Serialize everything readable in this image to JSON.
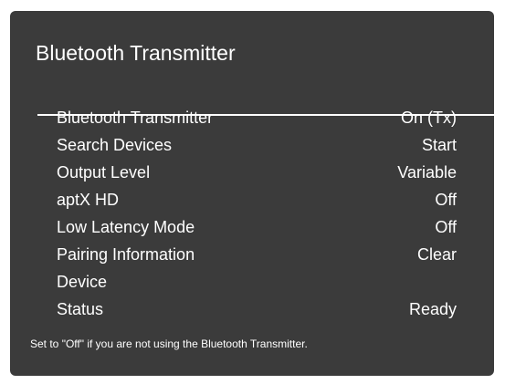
{
  "panel": {
    "title": "Bluetooth Transmitter"
  },
  "menu": {
    "items": [
      {
        "label": "Bluetooth Transmitter",
        "value": "On (Tx)",
        "selected": true
      },
      {
        "label": "Search Devices",
        "value": "Start"
      },
      {
        "label": "Output Level",
        "value": "Variable"
      },
      {
        "label": "aptX HD",
        "value": "Off"
      },
      {
        "label": "Low Latency Mode",
        "value": "Off"
      },
      {
        "label": "Pairing Information",
        "value": "Clear"
      },
      {
        "label": "Device",
        "value": ""
      },
      {
        "label": "Status",
        "value": "Ready"
      }
    ]
  },
  "help_text": "Set to \"Off\" if you are not using the Bluetooth Transmitter.",
  "colors": {
    "panel_background": "#3b3b3b",
    "text": "#ffffff",
    "page_background": "#ffffff"
  }
}
